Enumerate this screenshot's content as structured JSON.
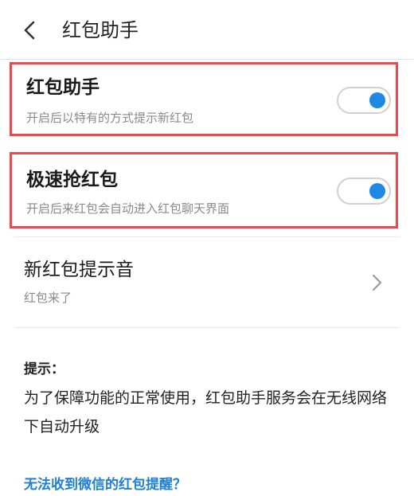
{
  "header": {
    "title": "红包助手",
    "back_icon": "chevron-left-icon"
  },
  "settings": [
    {
      "title": "红包助手",
      "subtitle": "开启后以特有的方式提示新红包",
      "enabled": true
    },
    {
      "title": "极速抢红包",
      "subtitle": "开启后来红包会自动进入红包聊天界面",
      "enabled": true
    }
  ],
  "sound": {
    "title": "新红包提示音",
    "value": "红包来了",
    "icon": "chevron-right-icon"
  },
  "tip": {
    "label": "提示：",
    "text": "为了保障功能的正常使用，红包助手服务会在无线网络下自动升级"
  },
  "help_link": "无法收到微信的红包提醒？",
  "colors": {
    "highlight_border": "#e84a4f",
    "toggle_on": "#1e88e5",
    "link": "#1e7fd6"
  }
}
